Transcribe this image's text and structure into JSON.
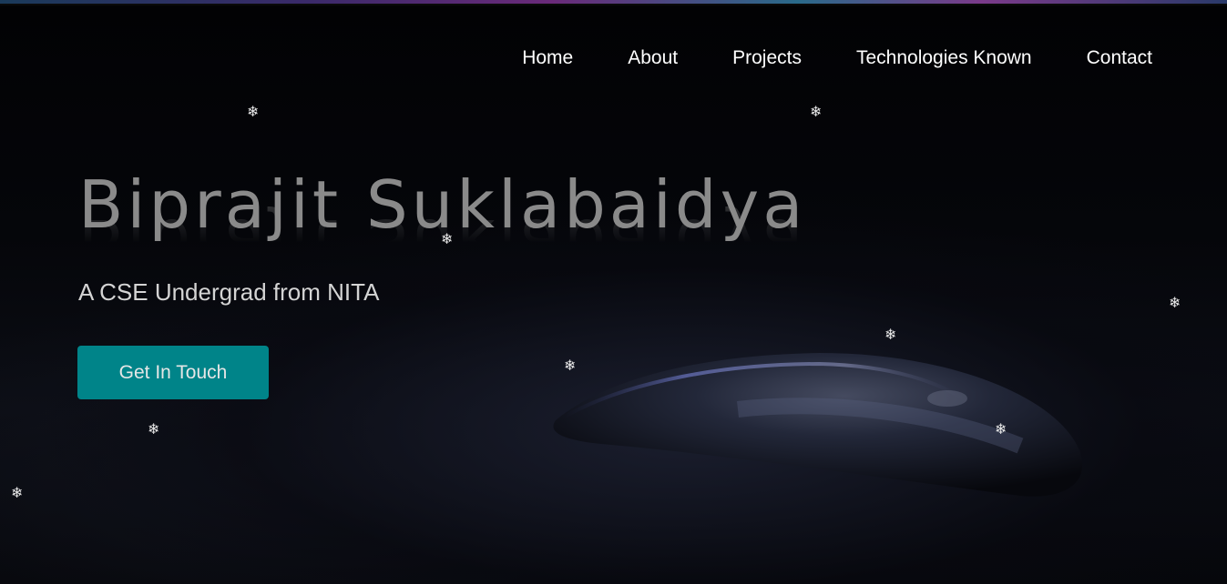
{
  "nav": {
    "items": [
      {
        "label": "Home"
      },
      {
        "label": "About"
      },
      {
        "label": "Projects"
      },
      {
        "label": "Technologies Known"
      },
      {
        "label": "Contact"
      }
    ]
  },
  "hero": {
    "title": "Biprajit Suklabaidya",
    "subtitle": "A CSE Undergrad from NITA",
    "cta_label": "Get In Touch"
  },
  "decor": {
    "snowflake_glyph": "❄",
    "snowflake_icon": "snowflake-icon",
    "accent_color": "#008489"
  }
}
